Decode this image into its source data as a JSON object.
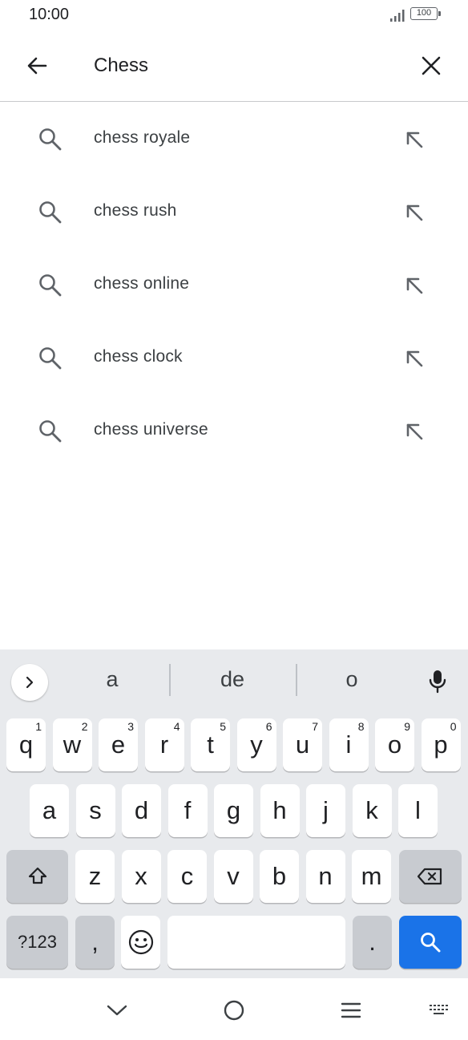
{
  "status": {
    "time": "10:00",
    "battery": "100",
    "signal_icon": "signal-icon"
  },
  "search": {
    "query": "Chess",
    "back_icon": "arrow-back-icon",
    "clear_icon": "close-icon"
  },
  "suggestions": [
    {
      "text": "chess royale"
    },
    {
      "text": "chess rush"
    },
    {
      "text": "chess online"
    },
    {
      "text": "chess clock"
    },
    {
      "text": "chess universe"
    }
  ],
  "keyboard": {
    "word_suggestions": [
      "a",
      "de",
      "o"
    ],
    "row1": [
      {
        "k": "q",
        "n": "1"
      },
      {
        "k": "w",
        "n": "2"
      },
      {
        "k": "e",
        "n": "3"
      },
      {
        "k": "r",
        "n": "4"
      },
      {
        "k": "t",
        "n": "5"
      },
      {
        "k": "y",
        "n": "6"
      },
      {
        "k": "u",
        "n": "7"
      },
      {
        "k": "i",
        "n": "8"
      },
      {
        "k": "o",
        "n": "9"
      },
      {
        "k": "p",
        "n": "0"
      }
    ],
    "row2": [
      "a",
      "s",
      "d",
      "f",
      "g",
      "h",
      "j",
      "k",
      "l"
    ],
    "row3": [
      "z",
      "x",
      "c",
      "v",
      "b",
      "n",
      "m"
    ],
    "symbols_label": "?123",
    "comma_label": ",",
    "period_label": ".",
    "accent_color": "#1a73e8"
  }
}
